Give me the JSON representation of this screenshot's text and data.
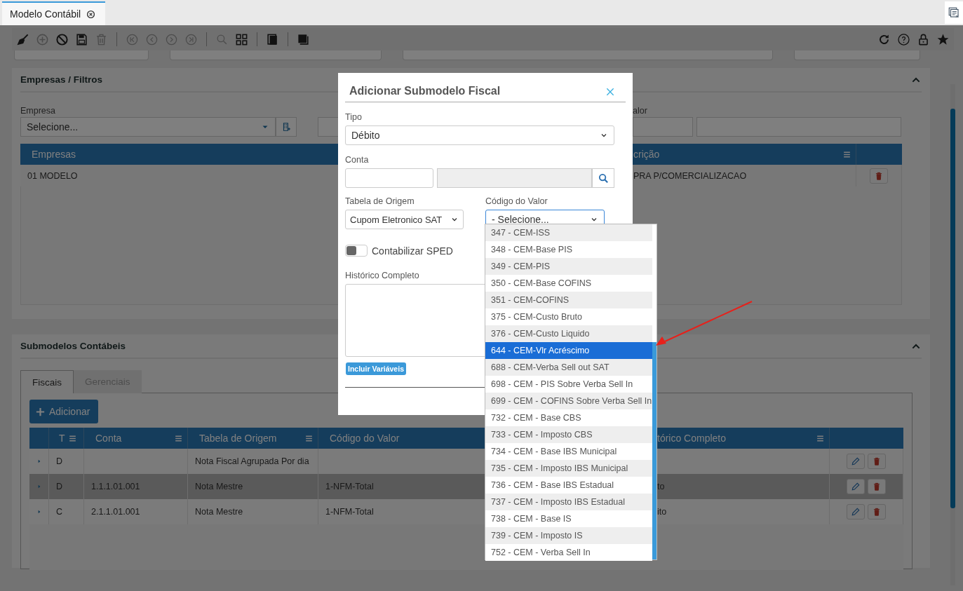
{
  "tab": {
    "label": "Modelo Contábil"
  },
  "toolbar": [
    {
      "disabled": false
    },
    {
      "disabled": true
    },
    {
      "disabled": false
    },
    {
      "disabled": false
    },
    {
      "disabled": true
    },
    {
      "disabled": true
    },
    {
      "disabled": true
    },
    {
      "disabled": true
    },
    {
      "disabled": true
    },
    {
      "disabled": true
    },
    {
      "disabled": false
    },
    {
      "disabled": false
    },
    {
      "disabled": false
    }
  ],
  "empresas_panel": {
    "title": "Empresas / Filtros",
    "empresa_label": "Empresa",
    "empresa_value": "Selecione...",
    "valor_label": "alor",
    "table": {
      "columns": [
        "Empresas",
        "crição"
      ],
      "rows": [
        {
          "empresa": "01 MODELO",
          "descricao": "PRA P/COMERCIALIZACAO"
        }
      ]
    }
  },
  "submodelos_panel": {
    "title": "Submodelos Contábeis",
    "tabs": [
      {
        "label": "Fiscais",
        "selected": true
      },
      {
        "label": "Gerenciais",
        "selected": false
      }
    ],
    "add_button": "Adicionar",
    "table": {
      "columns": [
        "T",
        "Conta",
        "Tabela de Origem",
        "Código do Valor",
        "tórico Completo"
      ],
      "rows": [
        {
          "selected": false,
          "tipo": "D",
          "tabela_de_origem": "Nota Fiscal Agrupada Por dia"
        },
        {
          "selected": true,
          "tipo": "D",
          "conta": "1.1.1.01.001",
          "tabela_de_origem": "Nota Mestre",
          "codigo_do_valor": "1-NFM-Total",
          "historico_completo": "to"
        },
        {
          "selected": false,
          "tipo": "C",
          "conta": "2.1.1.01.001",
          "tabela_de_origem": "Nota Mestre",
          "codigo_do_valor": "1-NFM-Total",
          "historico_completo": "ito"
        }
      ]
    }
  },
  "modal": {
    "title": "Adicionar Submodelo Fiscal",
    "tipo": {
      "label": "Tipo",
      "value": "Débito"
    },
    "conta": {
      "label": "Conta"
    },
    "tabela_de_origem": {
      "label": "Tabela de Origem",
      "value": "Cupom Eletronico SAT"
    },
    "codigo_do_valor": {
      "label": "Código do Valor",
      "value": "- Selecione...",
      "expanded": true,
      "options": [
        {
          "label": "347 - CEM-ISS",
          "selected": false
        },
        {
          "label": "348 - CEM-Base PIS",
          "selected": false
        },
        {
          "label": "349 - CEM-PIS",
          "selected": false
        },
        {
          "label": "350 - CEM-Base COFINS",
          "selected": false
        },
        {
          "label": "351 - CEM-COFINS",
          "selected": false
        },
        {
          "label": "375 - CEM-Custo Bruto",
          "selected": false
        },
        {
          "label": "376 - CEM-Custo Liquido",
          "selected": false
        },
        {
          "label": "644 - CEM-Vlr Acréscimo",
          "selected": true
        },
        {
          "label": "688 - CEM-Verba Sell out SAT",
          "selected": false
        },
        {
          "label": "698 - CEM - PIS Sobre Verba Sell In",
          "selected": false
        },
        {
          "label": "699 - CEM - COFINS Sobre Verba Sell In",
          "selected": false
        },
        {
          "label": "732 - CEM - Base CBS",
          "selected": false
        },
        {
          "label": "733 - CEM - Imposto CBS",
          "selected": false
        },
        {
          "label": "734 - CEM - Base IBS Municipal",
          "selected": false
        },
        {
          "label": "735 - CEM - Imposto IBS Municipal",
          "selected": false
        },
        {
          "label": "736 - CEM - Base IBS Estadual",
          "selected": false
        },
        {
          "label": "737 - CEM - Imposto IBS Estadual",
          "selected": false
        },
        {
          "label": "738 - CEM - Base IS",
          "selected": false
        },
        {
          "label": "739 - CEM - Imposto IS",
          "selected": false
        },
        {
          "label": "752 - CEM - Verba Sell In",
          "selected": false
        }
      ]
    },
    "contabilizar_sped": {
      "label": "Contabilizar SPED",
      "on": false
    },
    "historico_completo": {
      "label": "Histórico Completo"
    },
    "incluir_button": "Incluir Variáveis"
  }
}
